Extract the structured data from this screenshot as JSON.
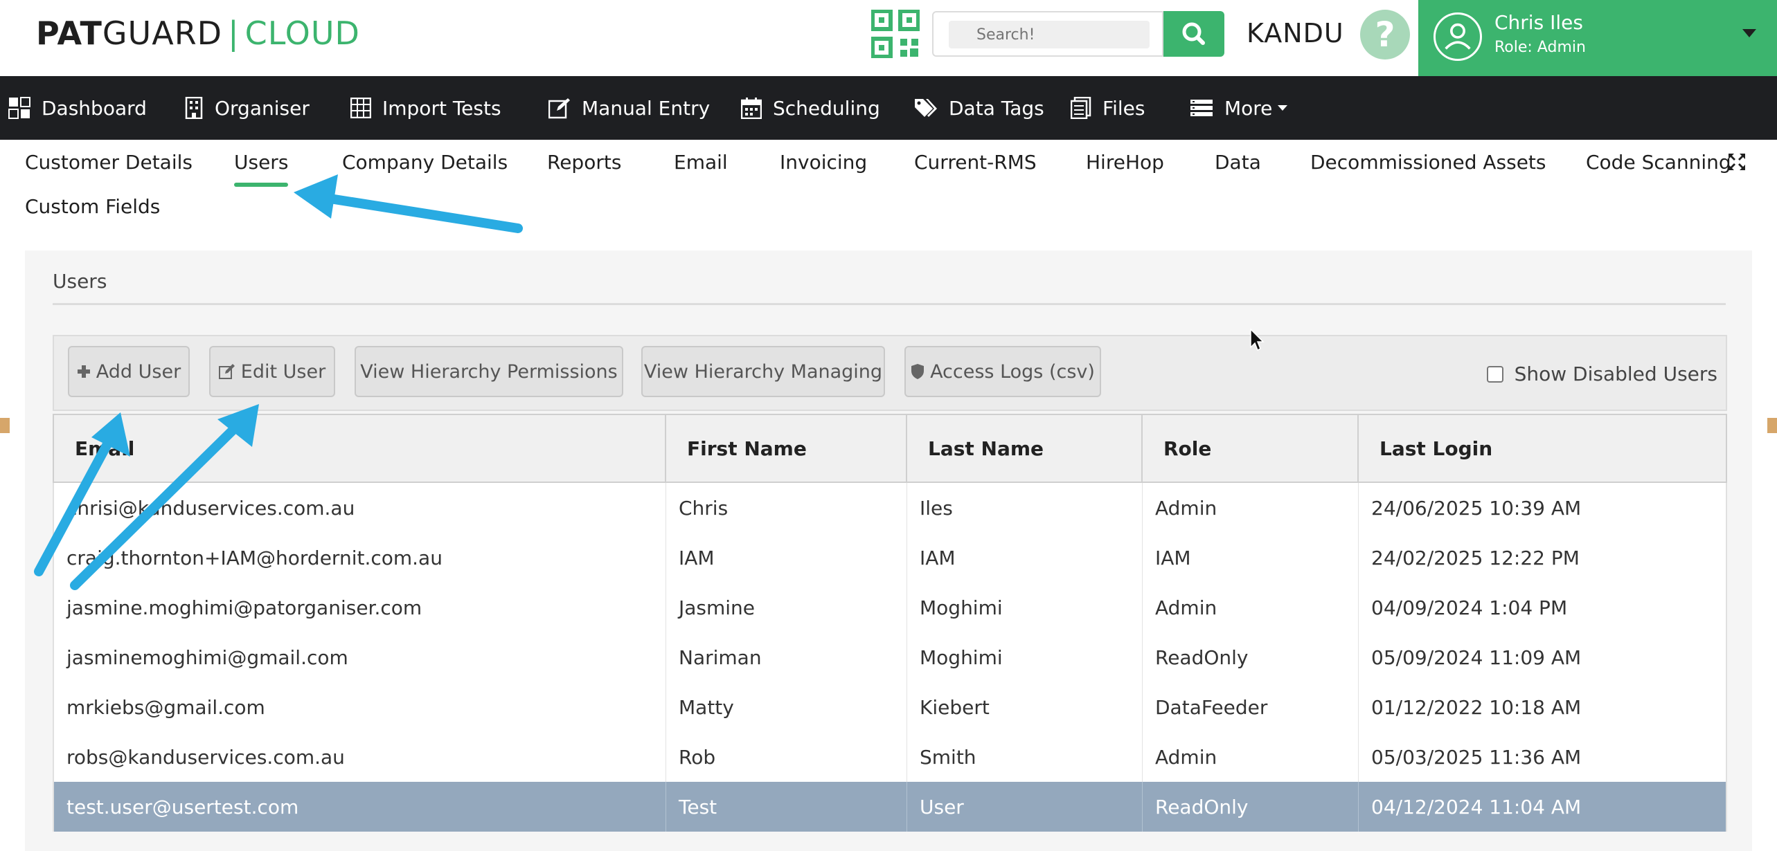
{
  "header": {
    "logo": {
      "bold": "PAT",
      "regular": "GUARD",
      "separator": "|",
      "accent": "CLOUD"
    },
    "search_placeholder": "Search!",
    "brand": "KANDU",
    "help_glyph": "?",
    "user": {
      "name": "Chris Iles",
      "role": "Role: Admin"
    }
  },
  "nav": {
    "items": [
      {
        "label": "Dashboard",
        "icon": "dashboard-icon"
      },
      {
        "label": "Organiser",
        "icon": "building-icon"
      },
      {
        "label": "Import Tests",
        "icon": "grid-icon"
      },
      {
        "label": "Manual Entry",
        "icon": "edit-icon"
      },
      {
        "label": "Scheduling",
        "icon": "calendar-icon"
      },
      {
        "label": "Data Tags",
        "icon": "tags-icon"
      },
      {
        "label": "Files",
        "icon": "files-icon"
      },
      {
        "label": "More",
        "icon": "list-icon"
      }
    ]
  },
  "tabs": {
    "items": [
      "Customer Details",
      "Users",
      "Company Details",
      "Reports",
      "Email",
      "Invoicing",
      "Current-RMS",
      "HireHop",
      "Data",
      "Decommissioned Assets",
      "Code Scanning",
      "Custom Fields"
    ],
    "active": "Users"
  },
  "panel": {
    "title": "Users",
    "toolbar": {
      "add_user": "Add User",
      "edit_user": "Edit User",
      "view_hierarchy_permissions": "View Hierarchy Permissions",
      "view_hierarchy_managing": "View Hierarchy Managing",
      "access_logs": "Access Logs (csv)",
      "show_disabled": "Show Disabled Users"
    },
    "table": {
      "headers": [
        "Email",
        "First Name",
        "Last Name",
        "Role",
        "Last Login"
      ],
      "rows": [
        [
          "chrisi@kanduservices.com.au",
          "Chris",
          "Iles",
          "Admin",
          "24/06/2025 10:39 AM"
        ],
        [
          "craig.thornton+IAM@hordernit.com.au",
          "IAM",
          "IAM",
          "IAM",
          "24/02/2025 12:22 PM"
        ],
        [
          "jasmine.moghimi@patorganiser.com",
          "Jasmine",
          "Moghimi",
          "Admin",
          "04/09/2024 1:04 PM"
        ],
        [
          "jasminemoghimi@gmail.com",
          "Nariman",
          "Moghimi",
          "ReadOnly",
          "05/09/2024 11:09 AM"
        ],
        [
          "mrkiebs@gmail.com",
          "Matty",
          "Kiebert",
          "DataFeeder",
          "01/12/2022 10:18 AM"
        ],
        [
          "robs@kanduservices.com.au",
          "Rob",
          "Smith",
          "Admin",
          "05/03/2025 11:36 AM"
        ],
        [
          "test.user@usertest.com",
          "Test",
          "User",
          "ReadOnly",
          "04/12/2024 11:04 AM"
        ]
      ],
      "selected_row": 6
    }
  },
  "colors": {
    "accent": "#3cb46e",
    "nav_bg": "#1e1f22",
    "selected_row": "#94a8bd",
    "arrow": "#29abe2"
  }
}
